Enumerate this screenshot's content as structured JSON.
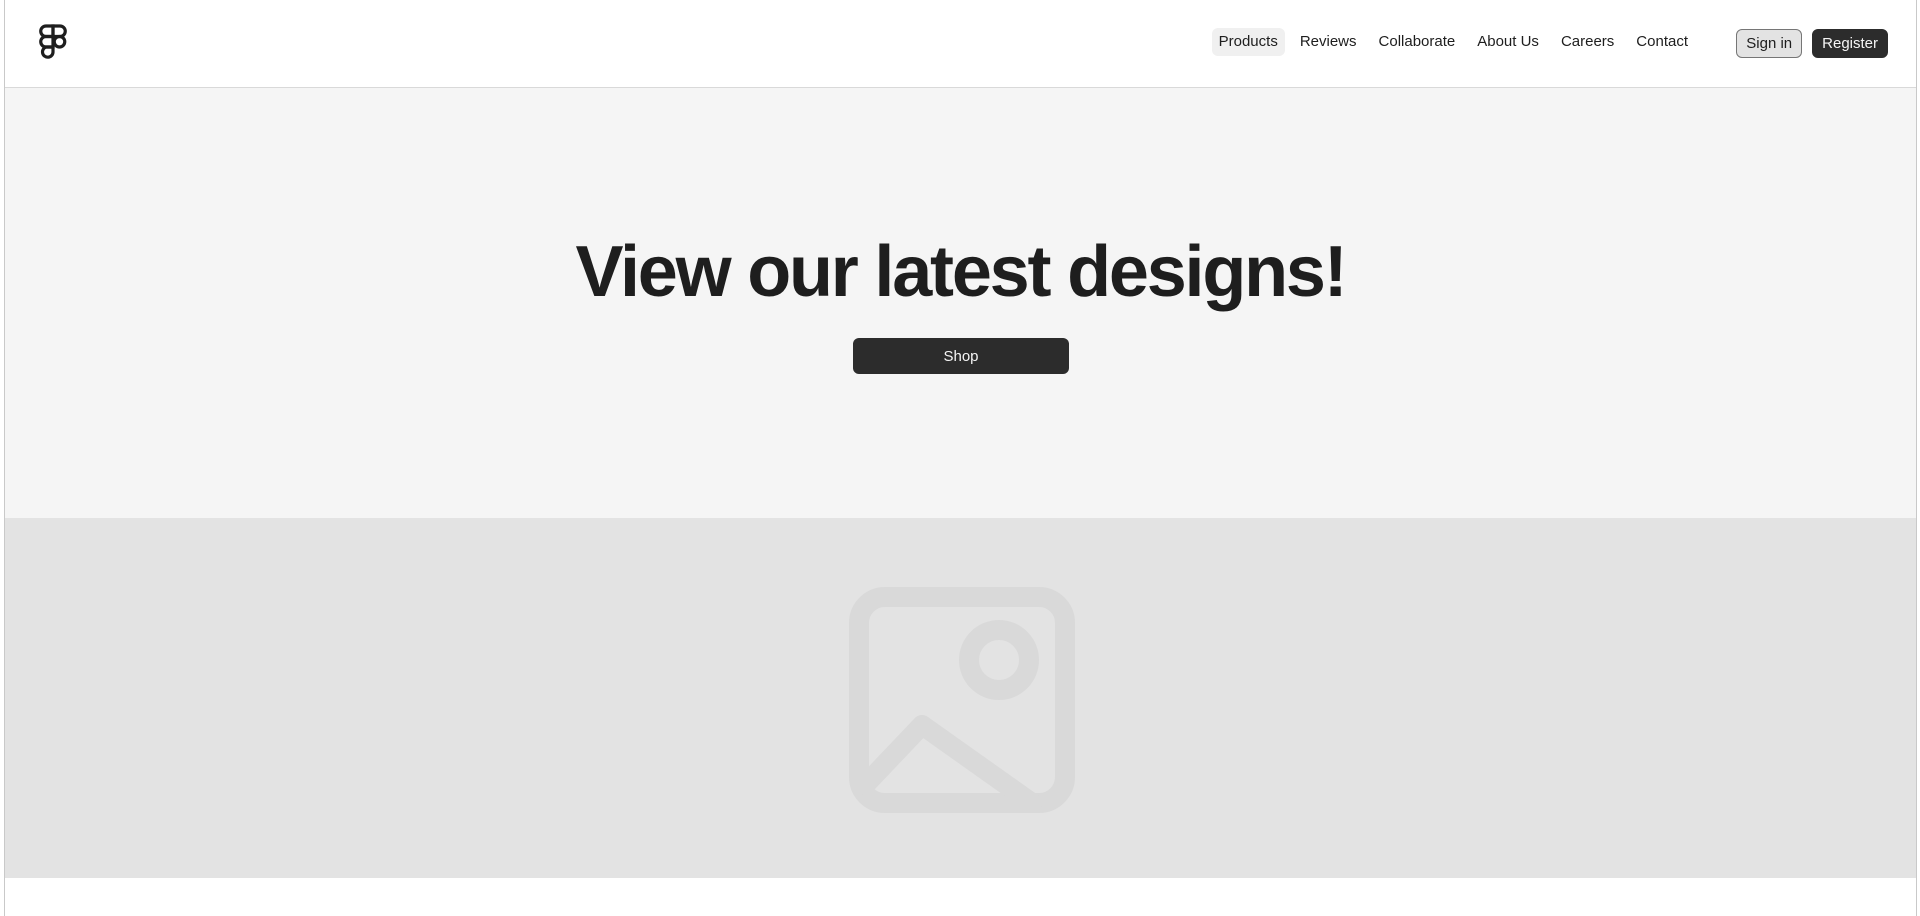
{
  "header": {
    "logo_icon": "figma-logo-icon",
    "nav": [
      {
        "label": "Products",
        "active": true
      },
      {
        "label": "Reviews",
        "active": false
      },
      {
        "label": "Collaborate",
        "active": false
      },
      {
        "label": "About Us",
        "active": false
      },
      {
        "label": "Careers",
        "active": false
      },
      {
        "label": "Contact",
        "active": false
      }
    ],
    "sign_in_label": "Sign in",
    "register_label": "Register"
  },
  "hero": {
    "title": "View our latest designs!",
    "shop_label": "Shop"
  },
  "image_section": {
    "icon": "image-placeholder-icon"
  },
  "colors": {
    "primary": "#2c2c2c",
    "hero_bg": "#f5f5f5",
    "image_bg": "#e3e3e3",
    "placeholder_icon": "#d9d9d9"
  }
}
